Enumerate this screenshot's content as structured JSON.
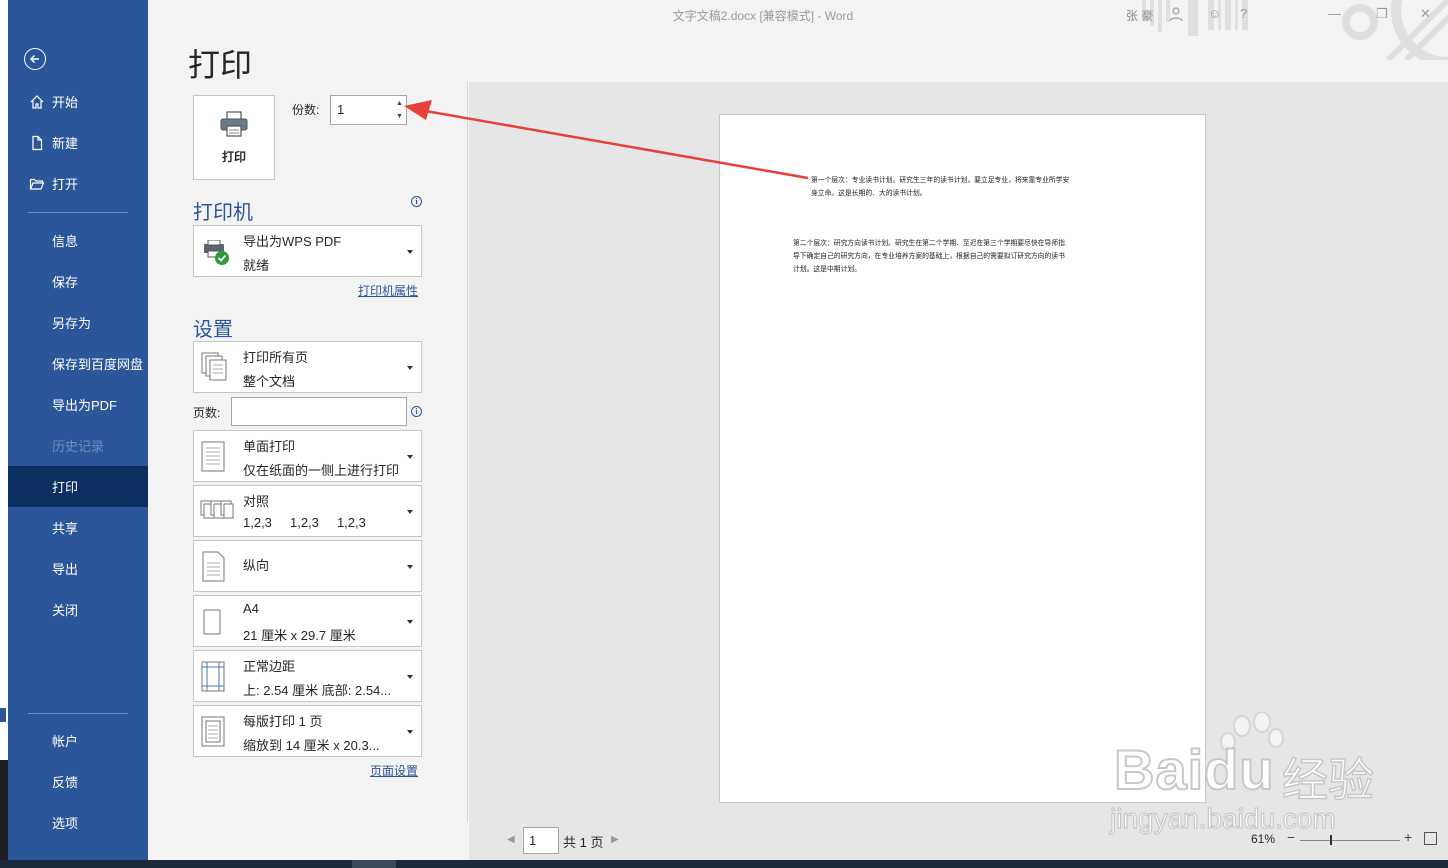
{
  "window": {
    "title": "文字文稿2.docx [兼容模式]  -  Word",
    "user": "张 豪"
  },
  "nav": {
    "items": [
      {
        "label": "开始",
        "icon": "home-icon"
      },
      {
        "label": "新建",
        "icon": "new-document-icon"
      },
      {
        "label": "打开",
        "icon": "open-folder-icon"
      },
      {
        "label": "信息"
      },
      {
        "label": "保存"
      },
      {
        "label": "另存为"
      },
      {
        "label": "保存到百度网盘"
      },
      {
        "label": "导出为PDF"
      },
      {
        "label": "历史记录",
        "disabled": true
      },
      {
        "label": "打印",
        "active": true
      },
      {
        "label": "共享"
      },
      {
        "label": "导出"
      },
      {
        "label": "关闭"
      },
      {
        "label": "帐户"
      },
      {
        "label": "反馈"
      },
      {
        "label": "选项"
      }
    ]
  },
  "print": {
    "heading": "打印",
    "print_button_label": "打印",
    "copies_label": "份数:",
    "copies_value": "1",
    "printer_heading": "打印机",
    "printer_name": "导出为WPS PDF",
    "printer_status": "就绪",
    "printer_properties_link": "打印机属性",
    "settings_heading": "设置",
    "pages_label": "页数:",
    "pages_value": "",
    "page_setup_link": "页面设置",
    "settings": [
      {
        "line1": "打印所有页",
        "line2": "整个文档"
      },
      {
        "line1": "单面打印",
        "line2": "仅在纸面的一侧上进行打印"
      },
      {
        "line1": "对照",
        "line2": "1,2,3     1,2,3     1,2,3"
      },
      {
        "line1": "纵向",
        "line2": ""
      },
      {
        "line1": "A4",
        "line2": "21 厘米 x 29.7 厘米"
      },
      {
        "line1": "正常边距",
        "line2": "上: 2.54 厘米 底部: 2.54..."
      },
      {
        "line1": "每版打印 1 页",
        "line2": "缩放到 14 厘米 x 20.3..."
      }
    ]
  },
  "preview": {
    "paragraph1_l1": "第一个层次：专业读书计划。研究生三年的读书计划，要立足专业，将来靠专业所学安",
    "paragraph1_l2": "身立命。这是长期的、大的读书计划。",
    "paragraph2_l1": "第二个层次：研究方向读书计划。研究生在第二个学期、至迟在第三个学期要尽快在导师指",
    "paragraph2_l2": "导下确定自己的研究方向，在专业培养方案的基础上，根据自己的需要拟订研究方向的读书",
    "paragraph2_l3": "计划。这是中期计划。",
    "current_page": "1",
    "total_pages": "共 1 页",
    "zoom": "61%",
    "zoom_level_fraction": 0.3
  },
  "watermark": {
    "brand": "Baidu",
    "cn": "经验",
    "url": "jingyan.baidu.com"
  },
  "colors": {
    "nav_bg": "#2b579a",
    "nav_active": "#0c2f62",
    "accent": "#2b579a",
    "annotation_arrow": "#e8403a"
  }
}
